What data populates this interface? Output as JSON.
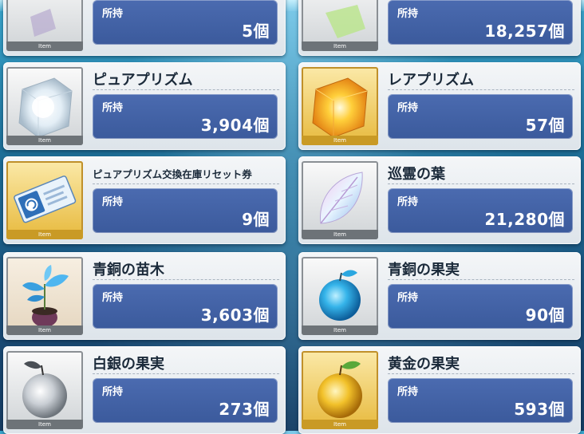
{
  "owned_label": "所持",
  "item_tag": "Item",
  "cards": [
    {
      "name": "",
      "count": "5個",
      "thumb": "silver-item-icon"
    },
    {
      "name": "",
      "count": "18,257個",
      "thumb": "green-item-icon"
    },
    {
      "name": "ピュアプリズム",
      "count": "3,904個",
      "thumb": "pure-prism-icon"
    },
    {
      "name": "レアプリズム",
      "count": "57個",
      "thumb": "rare-prism-icon"
    },
    {
      "name": "ピュアプリズム交換在庫リセット券",
      "count": "9個",
      "thumb": "reset-ticket-icon"
    },
    {
      "name": "巡霊の葉",
      "count": "21,280個",
      "thumb": "spirit-leaf-icon"
    },
    {
      "name": "青銅の苗木",
      "count": "3,603個",
      "thumb": "bronze-sapling-icon"
    },
    {
      "name": "青銅の果実",
      "count": "90個",
      "thumb": "bronze-fruit-icon"
    },
    {
      "name": "白銀の果実",
      "count": "273個",
      "thumb": "silver-fruit-icon"
    },
    {
      "name": "黄金の果実",
      "count": "593個",
      "thumb": "golden-fruit-icon"
    }
  ]
}
